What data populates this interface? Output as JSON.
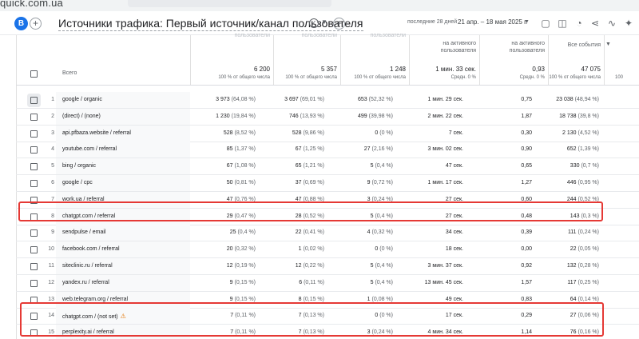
{
  "browser": {
    "url_fragment": "quick.com.ua"
  },
  "header": {
    "title": "Источники трафика: Первый источник/канал пользователя",
    "avatar_letter": "B",
    "date_label": "последние 28 дней",
    "date_range": "21 апр. – 18 мая 2025 г."
  },
  "columns": [
    {
      "label": "пользователи",
      "total": "6 200",
      "sub": "100 % от общего числа"
    },
    {
      "label": "пользователи",
      "total": "5 357",
      "sub": "100 % от общего числа"
    },
    {
      "label": "пользователи",
      "total": "1 248",
      "sub": "100 % от общего числа"
    },
    {
      "label": "на активного пользователя",
      "total": "1 мин. 33 сек.",
      "sub": "Средн. 0 %"
    },
    {
      "label": "на активного пользователя",
      "total": "0,93",
      "sub": "Средн. 0 %"
    },
    {
      "label": "Все события",
      "total": "47 075",
      "sub": "100 % от общего числа"
    }
  ],
  "edge_label": "100",
  "table": {
    "all_label": "Всего",
    "rows": [
      {
        "idx": "1",
        "dim": "google / organic",
        "c1": "3 973",
        "p1": "(64,08 %)",
        "c2": "3 697",
        "p2": "(69,01 %)",
        "c3": "653",
        "p3": "(52,32 %)",
        "c4": "1 мин. 29 сек.",
        "c5": "0,75",
        "c6": "23 038",
        "p6": "(48,94 %)"
      },
      {
        "idx": "2",
        "dim": "(direct) / (none)",
        "c1": "1 230",
        "p1": "(19,84 %)",
        "c2": "746",
        "p2": "(13,93 %)",
        "c3": "499",
        "p3": "(39,98 %)",
        "c4": "2 мин. 22 сек.",
        "c5": "1,87",
        "c6": "18 738",
        "p6": "(39,8 %)"
      },
      {
        "idx": "3",
        "dim": "api.pfbaza.website / referral",
        "c1": "528",
        "p1": "(8,52 %)",
        "c2": "528",
        "p2": "(9,86 %)",
        "c3": "0",
        "p3": "(0 %)",
        "c4": "7 сек.",
        "c5": "0,30",
        "c6": "2 130",
        "p6": "(4,52 %)"
      },
      {
        "idx": "4",
        "dim": "youtube.com / referral",
        "c1": "85",
        "p1": "(1,37 %)",
        "c2": "67",
        "p2": "(1,25 %)",
        "c3": "27",
        "p3": "(2,16 %)",
        "c4": "3 мин. 02 сек.",
        "c5": "0,90",
        "c6": "652",
        "p6": "(1,39 %)"
      },
      {
        "idx": "5",
        "dim": "bing / organic",
        "c1": "67",
        "p1": "(1,08 %)",
        "c2": "65",
        "p2": "(1,21 %)",
        "c3": "5",
        "p3": "(0,4 %)",
        "c4": "47 сек.",
        "c5": "0,65",
        "c6": "330",
        "p6": "(0,7 %)"
      },
      {
        "idx": "6",
        "dim": "google / cpc",
        "c1": "50",
        "p1": "(0,81 %)",
        "c2": "37",
        "p2": "(0,69 %)",
        "c3": "9",
        "p3": "(0,72 %)",
        "c4": "1 мин. 17 сек.",
        "c5": "1,27",
        "c6": "446",
        "p6": "(0,95 %)"
      },
      {
        "idx": "7",
        "dim": "work.ua / referral",
        "c1": "47",
        "p1": "(0,76 %)",
        "c2": "47",
        "p2": "(0,88 %)",
        "c3": "3",
        "p3": "(0,24 %)",
        "c4": "27 сек.",
        "c5": "0,60",
        "c6": "244",
        "p6": "(0,52 %)"
      },
      {
        "idx": "8",
        "dim": "chatgpt.com / referral",
        "c1": "29",
        "p1": "(0,47 %)",
        "c2": "28",
        "p2": "(0,52 %)",
        "c3": "5",
        "p3": "(0,4 %)",
        "c4": "27 сек.",
        "c5": "0,48",
        "c6": "143",
        "p6": "(0,3 %)"
      },
      {
        "idx": "9",
        "dim": "sendpulse / email",
        "c1": "25",
        "p1": "(0,4 %)",
        "c2": "22",
        "p2": "(0,41 %)",
        "c3": "4",
        "p3": "(0,32 %)",
        "c4": "34 сек.",
        "c5": "0,39",
        "c6": "111",
        "p6": "(0,24 %)"
      },
      {
        "idx": "10",
        "dim": "facebook.com / referral",
        "c1": "20",
        "p1": "(0,32 %)",
        "c2": "1",
        "p2": "(0,02 %)",
        "c3": "0",
        "p3": "(0 %)",
        "c4": "18 сек.",
        "c5": "0,00",
        "c6": "22",
        "p6": "(0,05 %)"
      },
      {
        "idx": "11",
        "dim": "siteclinic.ru / referral",
        "c1": "12",
        "p1": "(0,19 %)",
        "c2": "12",
        "p2": "(0,22 %)",
        "c3": "5",
        "p3": "(0,4 %)",
        "c4": "3 мин. 37 сек.",
        "c5": "0,92",
        "c6": "132",
        "p6": "(0,28 %)"
      },
      {
        "idx": "12",
        "dim": "yandex.ru / referral",
        "c1": "9",
        "p1": "(0,15 %)",
        "c2": "6",
        "p2": "(0,11 %)",
        "c3": "5",
        "p3": "(0,4 %)",
        "c4": "13 мин. 45 сек.",
        "c5": "1,57",
        "c6": "117",
        "p6": "(0,25 %)"
      },
      {
        "idx": "13",
        "dim": "web.telegram.org / referral",
        "c1": "9",
        "p1": "(0,15 %)",
        "c2": "8",
        "p2": "(0,15 %)",
        "c3": "1",
        "p3": "(0,08 %)",
        "c4": "49 сек.",
        "c5": "0,83",
        "c6": "64",
        "p6": "(0,14 %)"
      },
      {
        "idx": "14",
        "dim": "chatgpt.com / (not set)",
        "warn": "⚠",
        "c1": "7",
        "p1": "(0,11 %)",
        "c2": "7",
        "p2": "(0,13 %)",
        "c3": "0",
        "p3": "(0 %)",
        "c4": "17 сек.",
        "c5": "0,29",
        "c6": "27",
        "p6": "(0,06 %)"
      },
      {
        "idx": "15",
        "dim": "perplexity.ai / referral",
        "c1": "7",
        "p1": "(0,11 %)",
        "c2": "7",
        "p2": "(0,13 %)",
        "c3": "3",
        "p3": "(0,24 %)",
        "c4": "4 мин. 34 сек.",
        "c5": "1,14",
        "c6": "76",
        "p6": "(0,16 %)"
      }
    ]
  },
  "colors": {
    "accent": "#1a73e8",
    "highlight": "#e53935",
    "warning": "#e37400"
  }
}
